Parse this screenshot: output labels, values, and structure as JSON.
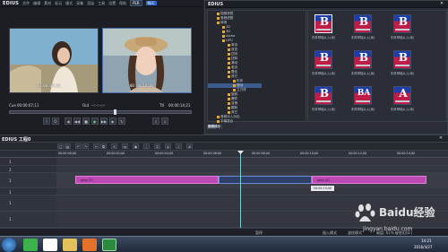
{
  "app": {
    "title": "EDIUS",
    "menu": [
      "文件",
      "编辑",
      "素材",
      "标记",
      "模式",
      "采集",
      "渲染",
      "工具",
      "设置",
      "帮助"
    ],
    "plr_label": "PLR",
    "rec_label": "REC"
  },
  "player": {
    "left_timecode": "00:00:07;11",
    "right_timecode": "00:00:10;00",
    "cue_label": "Cue",
    "cue_value": "00:00:07;11",
    "out_label": "Out",
    "out_value": "--:--:--;--",
    "ttl_label": "Ttl",
    "ttl_value": "00:00:14;21"
  },
  "bin": {
    "title": "EDIUS",
    "tree": [
      "视频滤镜",
      "音频滤镜",
      "转场",
      "2D",
      "3D",
      "Alpha",
      "GPU",
      "单页",
      "双页",
      "四页",
      "扭转",
      "滑动",
      "卷页",
      "叠化",
      "其它",
      "形状",
      "摆动",
      "立方体",
      "旋转",
      "爆炸",
      "变换",
      "翻转",
      "其它",
      "音频淡入淡出",
      "字幕混合"
    ],
    "thumb_caption": "手风琴轴从入(深)",
    "thumbnails": [
      {
        "letter": "B",
        "selected": true
      },
      {
        "letter": "B",
        "selected": false
      },
      {
        "letter": "B",
        "selected": false
      },
      {
        "letter": "B",
        "selected": false
      },
      {
        "letter": "B",
        "selected": false
      },
      {
        "letter": "B",
        "selected": false
      },
      {
        "letter": "B",
        "selected": false
      },
      {
        "letter": "BA",
        "selected": false
      },
      {
        "letter": "A",
        "selected": false
      }
    ],
    "tabs": [
      "素材库",
      "特效",
      "序列标记",
      "源素材",
      "素材转换"
    ]
  },
  "timeline": {
    "header": "EDIUS 工程0",
    "ruler_marks": [
      "00:00:00;00",
      "00:00:02;00",
      "00:00:04;00",
      "00:00:06;00",
      "00:00:08;00",
      "00:00:10;00",
      "00:00:12;00",
      "00:00:14;00"
    ],
    "clips": [
      {
        "name": "jpeg (2)"
      },
      {
        "name": "jpeg (4)"
      }
    ],
    "tooltip": "00:00:10;00",
    "tracks": [
      "1",
      "2",
      "1",
      "1",
      "1",
      "1"
    ]
  },
  "status": {
    "left": "",
    "center": "暂停",
    "right_items": [
      "插入模式",
      "波纹模式",
      "磁盘: 61% 被使用(D:)"
    ]
  },
  "taskbar": {
    "time": "14:21",
    "date": "2016/4/27"
  },
  "watermark": {
    "brand": "Baidu经验",
    "url": "jingyan.baidu.com"
  }
}
